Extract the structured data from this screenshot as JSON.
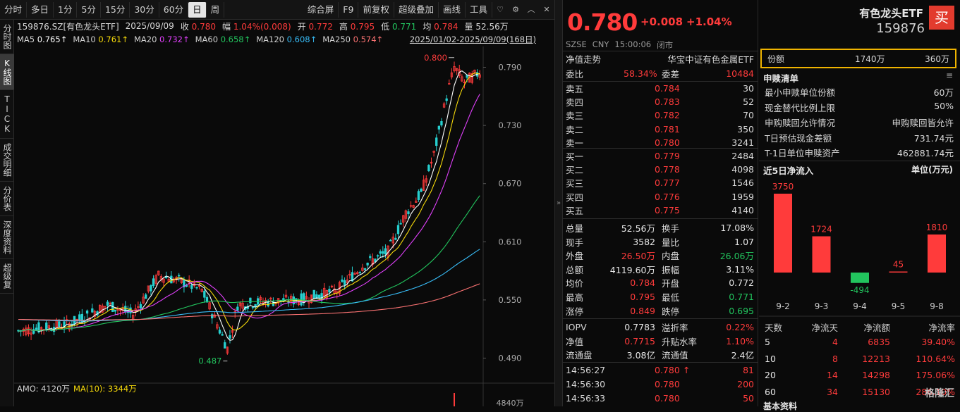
{
  "toolbar": {
    "left": [
      "分时",
      "多日",
      "1分",
      "5分",
      "15分",
      "30分",
      "60分",
      "日",
      "周"
    ],
    "active": "日",
    "right": [
      "综合屏",
      "F9",
      "前复权",
      "超级叠加",
      "画线",
      "工具"
    ],
    "icons": [
      "heart-icon",
      "settings-icon",
      "chevron-up-icon",
      "close-icon"
    ]
  },
  "vtabs": [
    "分时图",
    "K线图",
    "TICK",
    "成交明细",
    "分价表",
    "深度资料",
    "超级复"
  ],
  "info": {
    "code": "159876.SZ[有色龙头ETF]",
    "date": "2025/09/09",
    "close_l": "收",
    "close": "0.780",
    "amp_l": "幅",
    "amp": "1.04%(0.008)",
    "open_l": "开",
    "open": "0.772",
    "high_l": "高",
    "high": "0.795",
    "low_l": "低",
    "low": "0.771",
    "avg_l": "均",
    "avg": "0.784",
    "vol_l": "量",
    "vol": "52.56万"
  },
  "ma": {
    "items": [
      {
        "label": "MA5",
        "value": "0.765↑",
        "color": "#ffffff"
      },
      {
        "label": "MA10",
        "value": "0.761↑",
        "color": "#f5d90a"
      },
      {
        "label": "MA20",
        "value": "0.732↑",
        "color": "#e040fb"
      },
      {
        "label": "MA60",
        "value": "0.658↑",
        "color": "#22c55e"
      },
      {
        "label": "MA120",
        "value": "0.608↑",
        "color": "#38bdf8"
      },
      {
        "label": "MA250",
        "value": "0.574↑",
        "color": "#f87171"
      }
    ],
    "range": "2025/01/02-2025/09/09(168日)"
  },
  "chart_data": {
    "type": "candlestick",
    "ylim": [
      0.47,
      0.81
    ],
    "ticks": [
      "0.790",
      "0.730",
      "0.670",
      "0.610",
      "0.550",
      "0.490"
    ],
    "tick_values": [
      0.79,
      0.73,
      0.67,
      0.61,
      0.55,
      0.49
    ],
    "max_label": "0.800",
    "min_label": "0.487",
    "max_value": 0.8,
    "min_value": 0.487,
    "candles": 168,
    "amo_label": "AMO: 4120万",
    "amo_ma_label": "MA(10): 3344万",
    "amo_tick": "4840万"
  },
  "quote": {
    "price": "0.780",
    "change": "+0.008",
    "pct": "+1.04%",
    "meta": [
      "SZSE",
      "CNY",
      "15:00:06",
      "闭市"
    ],
    "trend_label": "净值走势",
    "fund_full": "华宝中证有色金属ETF",
    "weibi_l": "委比",
    "weibi": "58.34%",
    "weicha_l": "委差",
    "weicha": "10484",
    "asks": [
      {
        "l": "卖五",
        "p": "0.784",
        "v": "30"
      },
      {
        "l": "卖四",
        "p": "0.783",
        "v": "52"
      },
      {
        "l": "卖三",
        "p": "0.782",
        "v": "70"
      },
      {
        "l": "卖二",
        "p": "0.781",
        "v": "350"
      },
      {
        "l": "卖一",
        "p": "0.780",
        "v": "3241"
      }
    ],
    "bids": [
      {
        "l": "买一",
        "p": "0.779",
        "v": "2484"
      },
      {
        "l": "买二",
        "p": "0.778",
        "v": "4098"
      },
      {
        "l": "买三",
        "p": "0.777",
        "v": "1546"
      },
      {
        "l": "买四",
        "p": "0.776",
        "v": "1959"
      },
      {
        "l": "买五",
        "p": "0.775",
        "v": "4140"
      }
    ],
    "stats": [
      {
        "l1": "总量",
        "v1": "52.56万",
        "c1": "white",
        "l2": "换手",
        "v2": "17.08%",
        "c2": "white"
      },
      {
        "l1": "现手",
        "v1": "3582",
        "c1": "white",
        "l2": "量比",
        "v2": "1.07",
        "c2": "white"
      },
      {
        "l1": "外盘",
        "v1": "26.50万",
        "c1": "red",
        "l2": "内盘",
        "v2": "26.06万",
        "c2": "green"
      },
      {
        "l1": "总额",
        "v1": "4119.60万",
        "c1": "white",
        "l2": "振幅",
        "v2": "3.11%",
        "c2": "white"
      },
      {
        "l1": "均价",
        "v1": "0.784",
        "c1": "red",
        "l2": "开盘",
        "v2": "0.772",
        "c2": "white"
      },
      {
        "l1": "最高",
        "v1": "0.795",
        "c1": "red",
        "l2": "最低",
        "v2": "0.771",
        "c2": "green"
      },
      {
        "l1": "涨停",
        "v1": "0.849",
        "c1": "red",
        "l2": "跌停",
        "v2": "0.695",
        "c2": "green"
      }
    ],
    "stats2": [
      {
        "l1": "IOPV",
        "v1": "0.7783",
        "c1": "white",
        "l2": "溢折率",
        "v2": "0.22%",
        "c2": "red"
      },
      {
        "l1": "净值",
        "v1": "0.7715",
        "c1": "red",
        "l2": "升贴水率",
        "v2": "1.10%",
        "c2": "red"
      },
      {
        "l1": "流通盘",
        "v1": "3.08亿",
        "c1": "white",
        "l2": "流通值",
        "v2": "2.4亿",
        "c2": "white"
      }
    ],
    "ticks": [
      {
        "t": "14:56:27",
        "p": "0.780",
        "arrow": "↑",
        "v": "81"
      },
      {
        "t": "14:56:30",
        "p": "0.780",
        "arrow": "",
        "v": "200"
      },
      {
        "t": "14:56:33",
        "p": "0.780",
        "arrow": "",
        "v": "50"
      }
    ]
  },
  "fund": {
    "name": "有色龙头ETF",
    "code": "159876",
    "buy": "买",
    "share_l": "份额",
    "share1": "1740万",
    "share2": "360万",
    "sg_title": "申赎清单",
    "sg": [
      {
        "l": "最小申赎单位份额",
        "v": "60万"
      },
      {
        "l": "现金替代比例上限",
        "v": "50%"
      },
      {
        "l": "申购赎回允许情况",
        "v": "申购赎回皆允许"
      },
      {
        "l": "T日预估现金差额",
        "v": "731.74元"
      },
      {
        "l": "T-1日单位申赎资产",
        "v": "462881.74元"
      }
    ],
    "flow_title": "近5日净流入",
    "flow_unit": "单位(万元)",
    "flow": [
      {
        "d": "9-2",
        "v": 3750
      },
      {
        "d": "9-3",
        "v": 1724
      },
      {
        "d": "9-4",
        "v": -494
      },
      {
        "d": "9-5",
        "v": 45
      },
      {
        "d": "9-8",
        "v": 1810
      }
    ],
    "table_head": [
      "天数",
      "净流天",
      "净流额",
      "净流率"
    ],
    "table": [
      [
        "5",
        "4",
        "6835",
        "39.40%"
      ],
      [
        "10",
        "8",
        "12213",
        "110.64%"
      ],
      [
        "20",
        "14",
        "14298",
        "175.06%"
      ],
      [
        "60",
        "34",
        "15130",
        "286.10%"
      ]
    ],
    "footer": "基本资料",
    "watermark": "格隆汇"
  }
}
